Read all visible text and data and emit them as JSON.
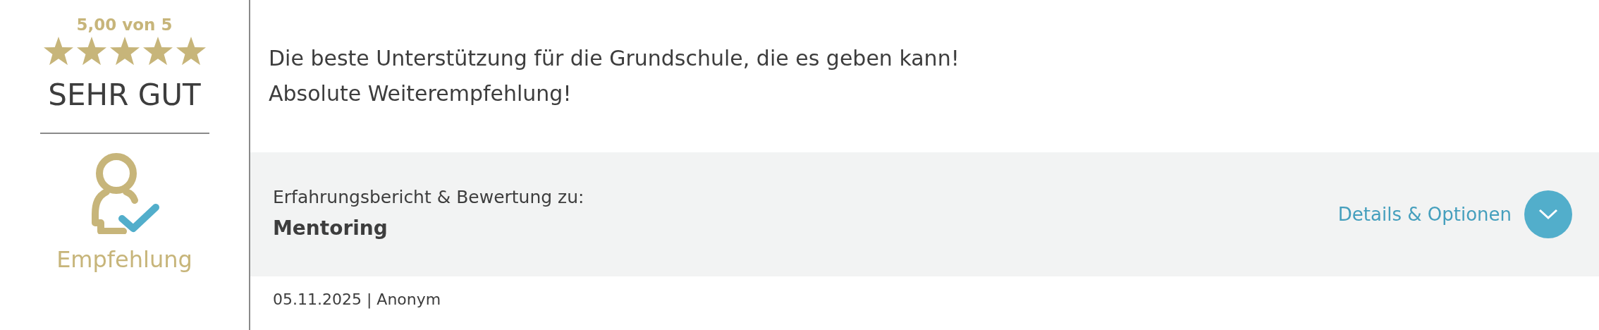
{
  "rating": {
    "score": "5,00 von 5",
    "stars": 5,
    "verdict": "SEHR GUT",
    "recommendation": "Empfehlung"
  },
  "review": {
    "text_lines": [
      "Die beste Unterstützung für die Grundschule, die es geben kann!",
      "Absolute Weiterempfehlung!"
    ],
    "subject_label": "Erfahrungsbericht & Bewertung zu:",
    "subject": "Mentoring",
    "details_link": "Details & Optionen",
    "meta": "05.11.2025 | Anonym"
  }
}
